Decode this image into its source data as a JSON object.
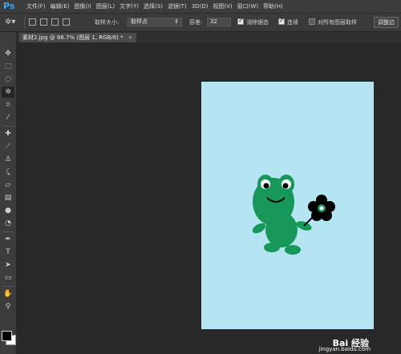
{
  "app": {
    "logo": "Ps"
  },
  "menu": [
    "文件(F)",
    "编辑(E)",
    "图像(I)",
    "图层(L)",
    "文字(Y)",
    "选择(S)",
    "滤镜(T)",
    "3D(D)",
    "视图(V)",
    "窗口(W)",
    "帮助(H)"
  ],
  "options": {
    "sample_size_label": "取样大小:",
    "sample_size_value": "取样点",
    "tolerance_label": "容差:",
    "tolerance_value": "32",
    "antialias_label": "消除锯齿",
    "antialias_checked": true,
    "contiguous_label": "连续",
    "contiguous_checked": true,
    "all_layers_label": "对所有图层取样",
    "all_layers_checked": false,
    "refine_edge_label": "调整边"
  },
  "document_tab": {
    "title": "素材2.jpg @ 66.7% (图层 1, RGB/8) *",
    "close": "×"
  },
  "tools": [
    "move-icon",
    "marquee-icon",
    "lasso-icon",
    "magic-wand-icon",
    "crop-icon",
    "eyedropper-icon",
    "healing-brush-icon",
    "brush-icon",
    "clone-stamp-icon",
    "history-brush-icon",
    "eraser-icon",
    "gradient-icon",
    "blur-icon",
    "dodge-icon",
    "pen-icon",
    "type-icon",
    "path-selection-icon",
    "rectangle-icon",
    "hand-icon",
    "zoom-icon"
  ],
  "colors": {
    "foreground": "#000000",
    "background": "#ffffff",
    "canvas": "#b5e4f2",
    "frog": "#17985a"
  },
  "watermark": {
    "brand": "Bai 经验",
    "url": "jingyan.baidu.com"
  }
}
